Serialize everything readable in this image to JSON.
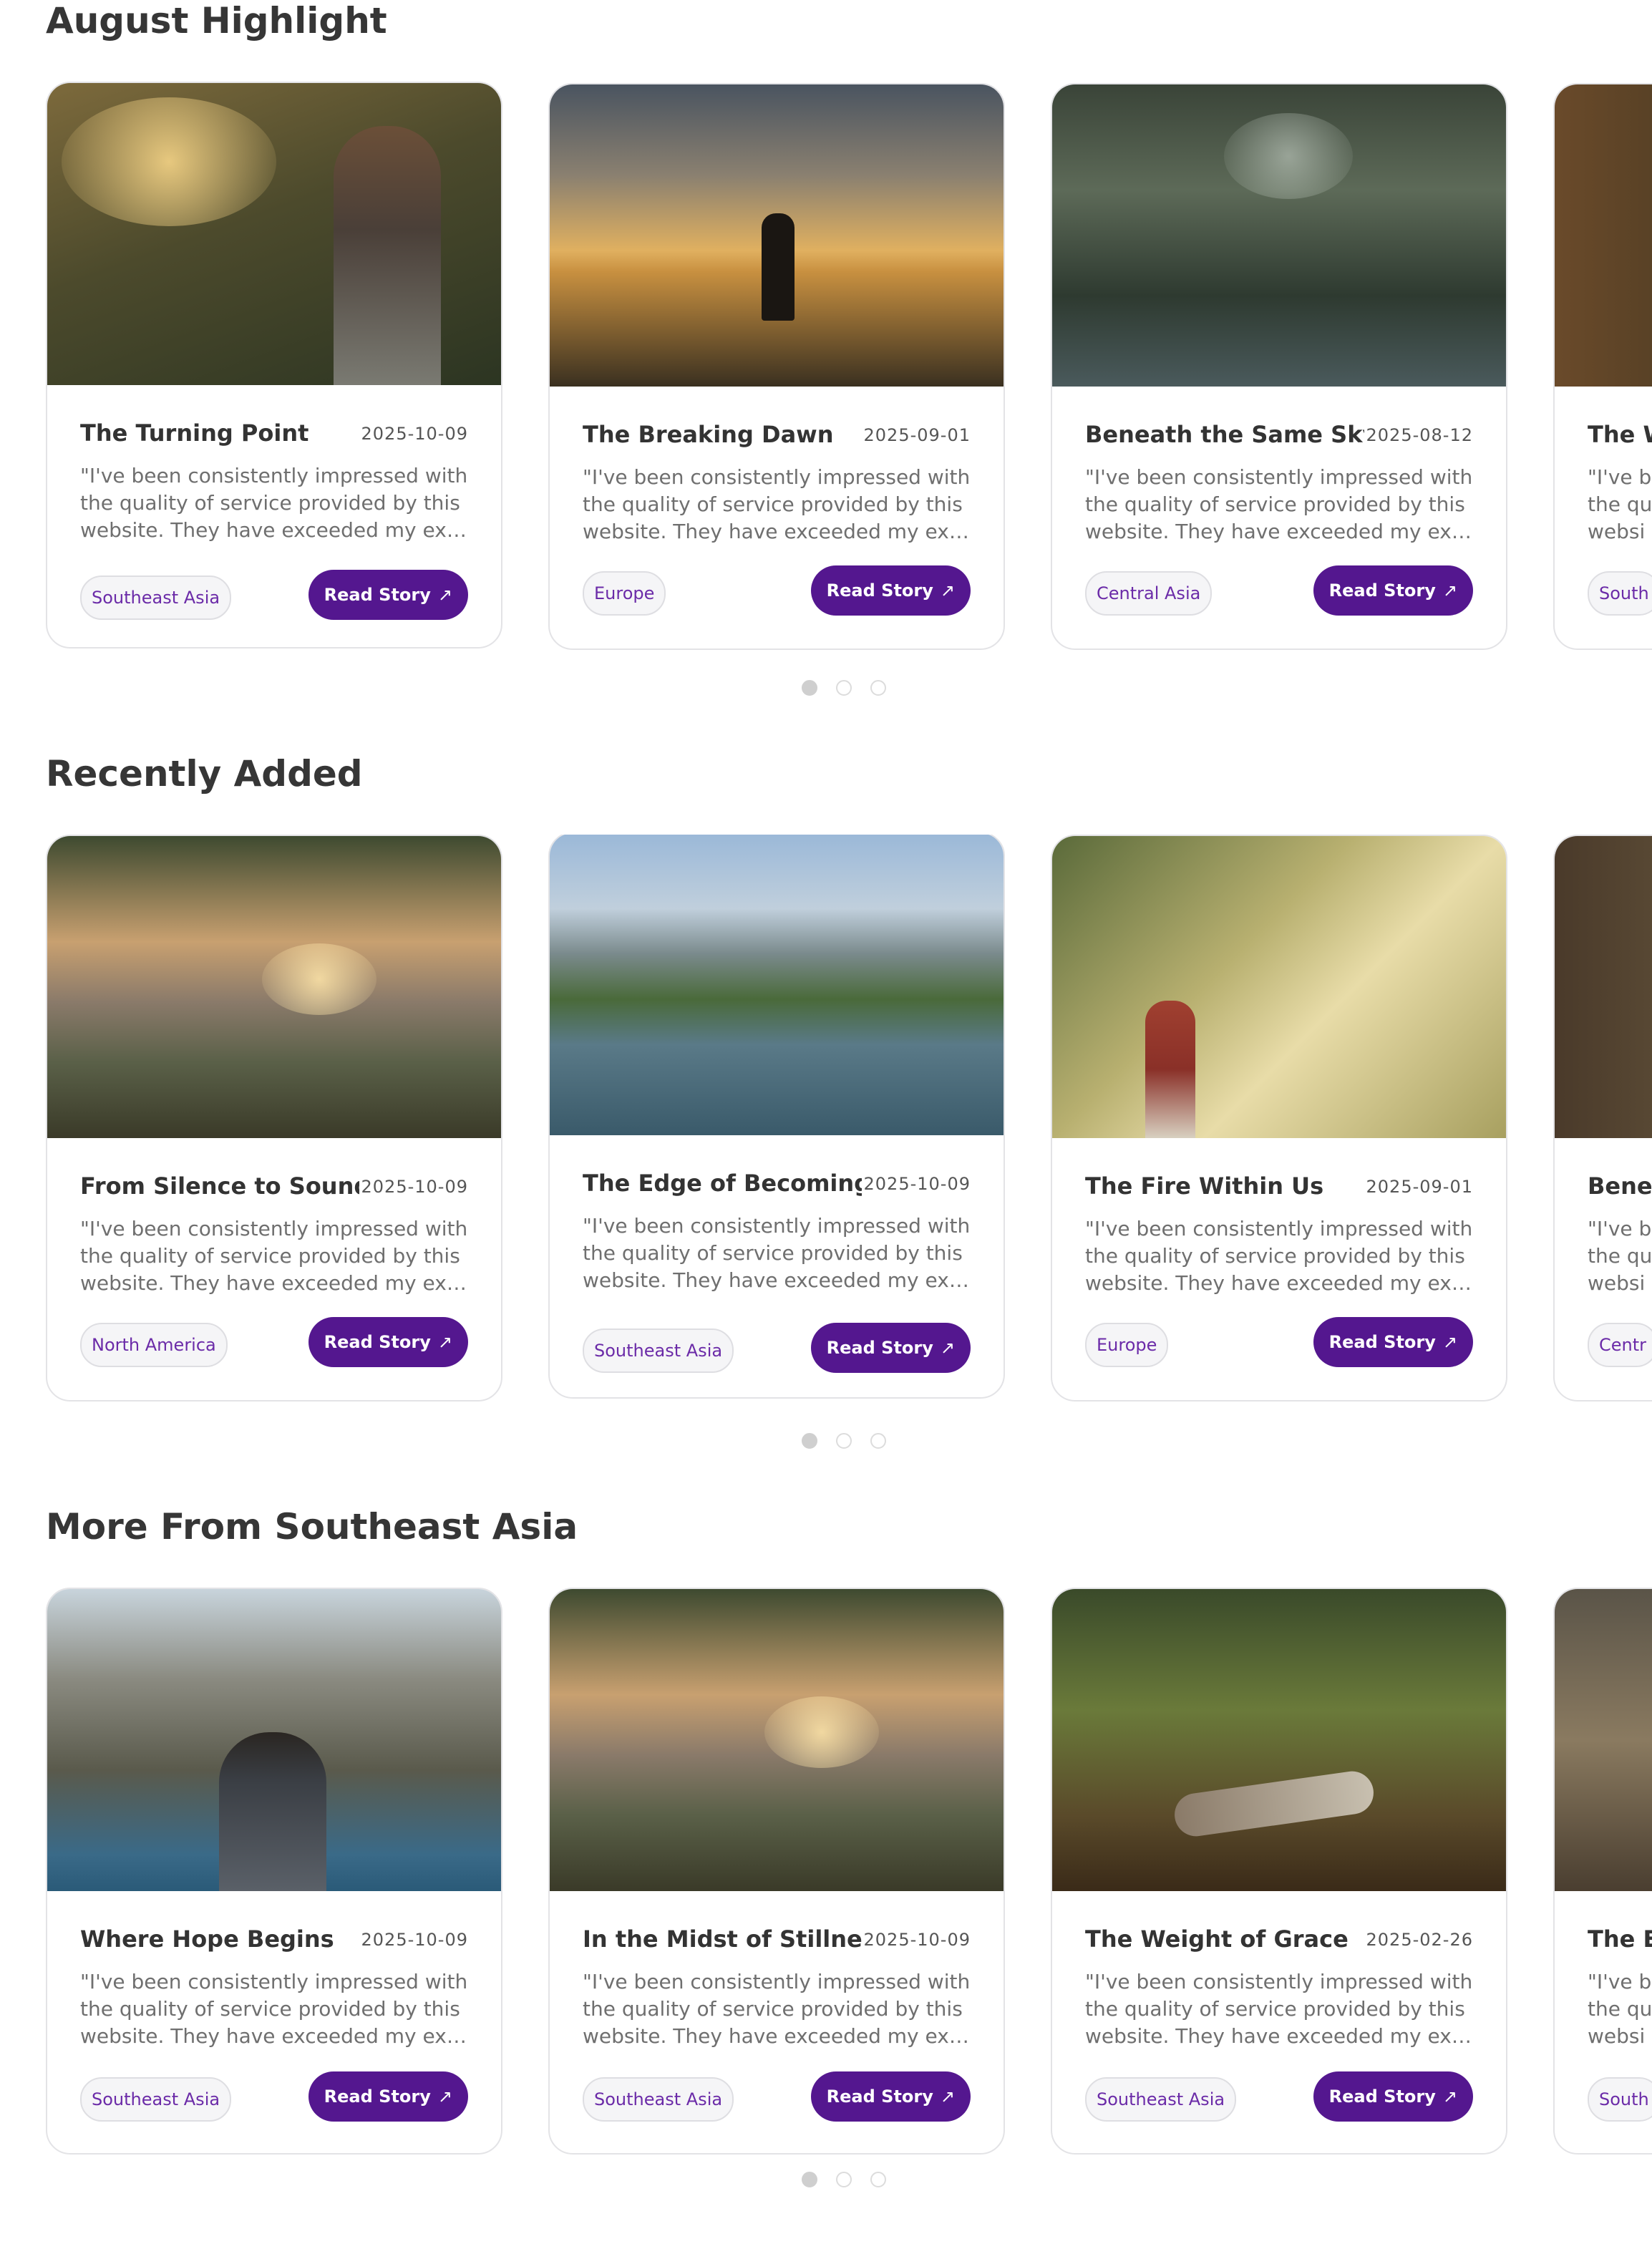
{
  "sections": [
    {
      "title": "August Highlight",
      "cards": [
        {
          "title": "The Turning Point",
          "date": "2025-10-09",
          "lines": [
            "\"I've been consistently impressed with",
            "the quality of service provided by this",
            "website. They have exceeded my exp..."
          ],
          "region": "Southeast Asia",
          "button": "Read Story"
        },
        {
          "title": "The Breaking Dawn",
          "date": "2025-09-01",
          "lines": [
            "\"I've been consistently impressed with",
            "the quality of service provided by this",
            "website. They have exceeded my exp..."
          ],
          "region": "Europe",
          "button": "Read Story"
        },
        {
          "title": "Beneath the Same Sky",
          "date": "2025-08-12",
          "lines": [
            "\"I've been consistently impressed with",
            "the quality of service provided by this",
            "website. They have exceeded my exp..."
          ],
          "region": "Central Asia",
          "button": "Read Story"
        },
        {
          "title": "The W",
          "date": "",
          "lines": [
            "\"I've b",
            "the qu",
            "websi"
          ],
          "region": "South",
          "button": ""
        }
      ]
    },
    {
      "title": "Recently Added",
      "cards": [
        {
          "title": "From Silence to Sound",
          "date": "2025-10-09",
          "lines": [
            "\"I've been consistently impressed with",
            "the quality of service provided by this",
            "website. They have exceeded my exp..."
          ],
          "region": "North America",
          "button": "Read Story"
        },
        {
          "title": "The Edge of Becoming",
          "date": "2025-10-09",
          "lines": [
            "\"I've been consistently impressed with",
            "the quality of service provided by this",
            "website. They have exceeded my exp..."
          ],
          "region": "Southeast Asia",
          "button": "Read Story"
        },
        {
          "title": "The Fire Within Us",
          "date": "2025-09-01",
          "lines": [
            "\"I've been consistently impressed with",
            "the quality of service provided by this",
            "website. They have exceeded my exp..."
          ],
          "region": "Europe",
          "button": "Read Story"
        },
        {
          "title": "Bene",
          "date": "",
          "lines": [
            "\"I've b",
            "the qu",
            "websi"
          ],
          "region": "Centr",
          "button": ""
        }
      ]
    },
    {
      "title": "More From Southeast Asia",
      "cards": [
        {
          "title": "Where Hope Begins",
          "date": "2025-10-09",
          "lines": [
            "\"I've been consistently impressed with",
            "the quality of service provided by this",
            "website. They have exceeded my exp..."
          ],
          "region": "Southeast Asia",
          "button": "Read Story"
        },
        {
          "title": "In the Midst of Stillness",
          "date": "2025-10-09",
          "lines": [
            "\"I've been consistently impressed with",
            "the quality of service provided by this",
            "website. They have exceeded my exp..."
          ],
          "region": "Southeast Asia",
          "button": "Read Story"
        },
        {
          "title": "The Weight of Grace",
          "date": "2025-02-26",
          "lines": [
            "\"I've been consistently impressed with",
            "the quality of service provided by this",
            "website. They have exceeded my exp..."
          ],
          "region": "Southeast Asia",
          "button": "Read Story"
        },
        {
          "title": "The E",
          "date": "",
          "lines": [
            "\"I've b",
            "the qu",
            "websi"
          ],
          "region": "South",
          "button": ""
        }
      ]
    }
  ],
  "button_icon": "arrow-up-right-icon",
  "colors": {
    "accent": "#54178f",
    "tag_text": "#6b2ba8",
    "tag_bg": "#f5f5f7",
    "border": "#e3e3e6"
  }
}
